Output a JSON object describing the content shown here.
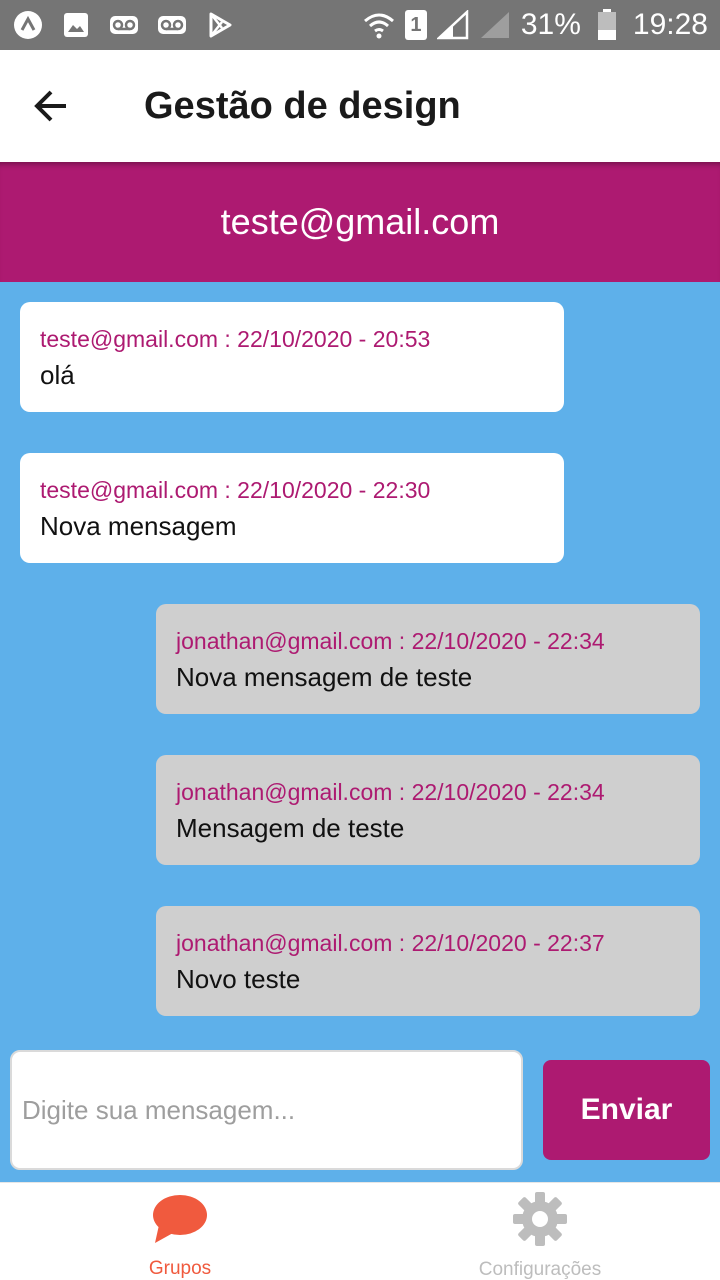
{
  "status_bar": {
    "battery": "31%",
    "time": "19:28",
    "sim_label": "1",
    "icons": [
      "app-icon",
      "image-icon",
      "voicemail-icon",
      "voicemail-icon",
      "play-store-icon",
      "wifi-icon",
      "sim-icon",
      "signal-icon",
      "signal-icon",
      "battery-icon"
    ]
  },
  "app_bar": {
    "title": "Gestão de design"
  },
  "contact": {
    "name": "teste@gmail.com"
  },
  "messages": [
    {
      "meta": "teste@gmail.com : 22/10/2020 - 20:53",
      "text": "olá",
      "side": "received"
    },
    {
      "meta": "teste@gmail.com : 22/10/2020 - 22:30",
      "text": "Nova mensagem",
      "side": "received"
    },
    {
      "meta": "jonathan@gmail.com : 22/10/2020 - 22:34",
      "text": "Nova mensagem de teste",
      "side": "sent"
    },
    {
      "meta": "jonathan@gmail.com : 22/10/2020 - 22:34",
      "text": "Mensagem de teste",
      "side": "sent"
    },
    {
      "meta": "jonathan@gmail.com : 22/10/2020 - 22:37",
      "text": "Novo teste",
      "side": "sent"
    }
  ],
  "composer": {
    "placeholder": "Digite sua mensagem...",
    "value": "",
    "send_label": "Enviar"
  },
  "bottom_nav": {
    "items": [
      {
        "label": "Grupos",
        "icon": "chat-bubble-icon",
        "active": true
      },
      {
        "label": "Configurações",
        "icon": "gear-icon",
        "active": false
      }
    ]
  },
  "colors": {
    "primary": "#ad1a71",
    "chat_background": "#5eb0ea",
    "received_bubble": "#ffffff",
    "sent_bubble": "#cfcfcf",
    "nav_active": "#f05a3e",
    "nav_inactive": "#bdbdbd",
    "status_bar": "#757575"
  }
}
